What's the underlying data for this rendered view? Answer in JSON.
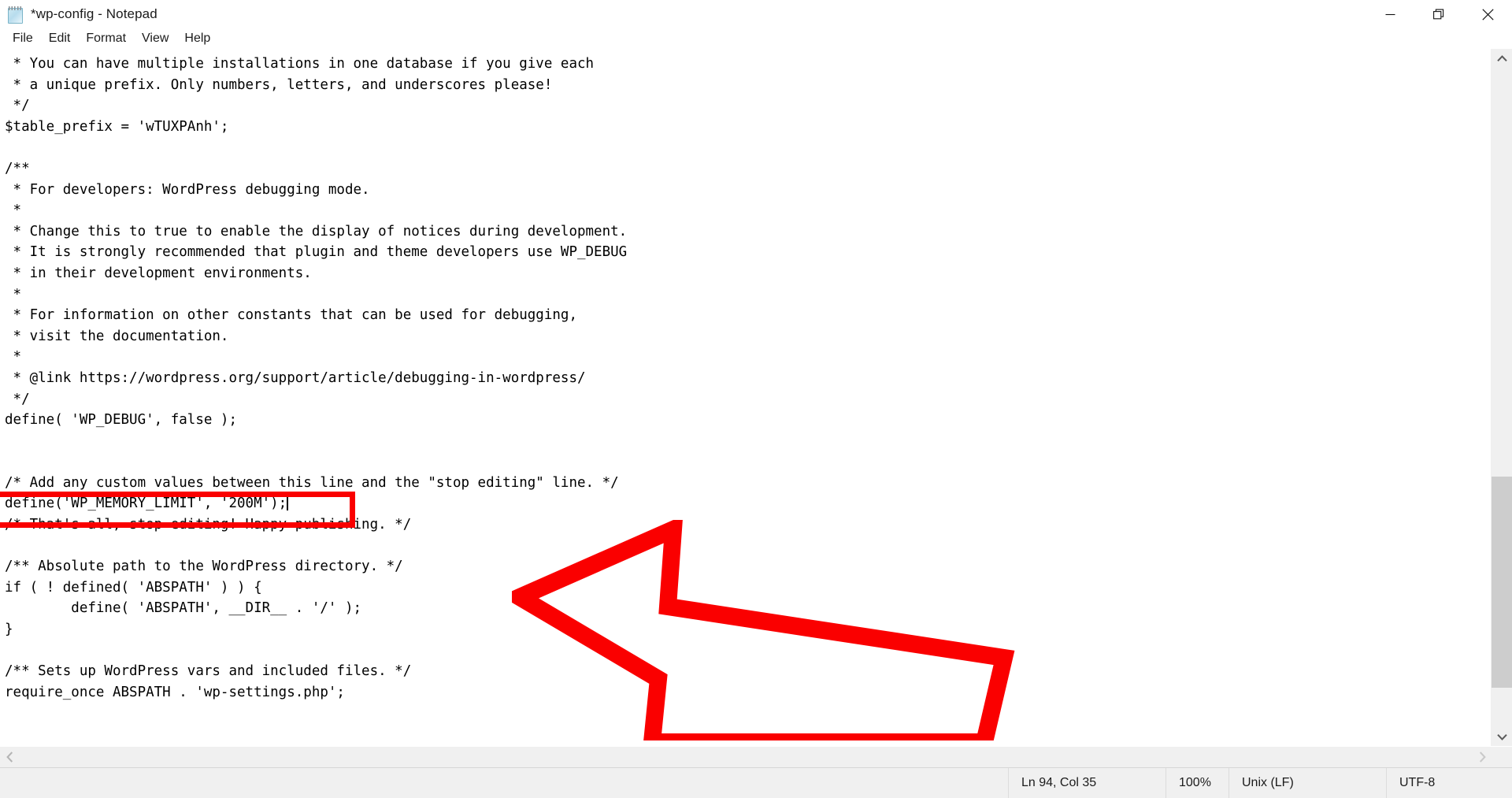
{
  "window": {
    "title": "*wp-config - Notepad",
    "icon": "notepad-icon",
    "controls": {
      "minimize": "minimize-icon",
      "restore": "restore-icon",
      "close": "close-icon"
    }
  },
  "menubar": {
    "items": [
      {
        "label": "File"
      },
      {
        "label": "Edit"
      },
      {
        "label": "Format"
      },
      {
        "label": "View"
      },
      {
        "label": "Help"
      }
    ]
  },
  "editor": {
    "lines": [
      " * You can have multiple installations in one database if you give each",
      " * a unique prefix. Only numbers, letters, and underscores please!",
      " */",
      "$table_prefix = 'wTUXPAnh';",
      "",
      "/**",
      " * For developers: WordPress debugging mode.",
      " *",
      " * Change this to true to enable the display of notices during development.",
      " * It is strongly recommended that plugin and theme developers use WP_DEBUG",
      " * in their development environments.",
      " *",
      " * For information on other constants that can be used for debugging,",
      " * visit the documentation.",
      " *",
      " * @link https://wordpress.org/support/article/debugging-in-wordpress/",
      " */",
      "define( 'WP_DEBUG', false );",
      "",
      "",
      "/* Add any custom values between this line and the \"stop editing\" line. */",
      "define('WP_MEMORY_LIMIT', '200M');",
      "/* That's all, stop editing! Happy publishing. */",
      "",
      "/** Absolute path to the WordPress directory. */",
      "if ( ! defined( 'ABSPATH' ) ) {",
      "        define( 'ABSPATH', __DIR__ . '/' );",
      "}",
      "",
      "/** Sets up WordPress vars and included files. */",
      "require_once ABSPATH . 'wp-settings.php';"
    ],
    "highlighted_line_index": 21,
    "highlighted_line_text": "define('WP_MEMORY_LIMIT', '200M');",
    "caret_after_line_index": 21
  },
  "annotation": {
    "type": "arrow",
    "direction": "left",
    "color": "#fa0000",
    "points_to": "define('WP_MEMORY_LIMIT', '200M');",
    "highlight_box_color": "#fa0000"
  },
  "scrollbars": {
    "vertical": {
      "up_icon": "chevron-up-icon",
      "down_icon": "chevron-down-icon",
      "thumb_top_pct": 62,
      "thumb_height_pct": 32
    },
    "horizontal": {
      "left_icon": "chevron-left-icon",
      "right_icon": "chevron-right-icon"
    }
  },
  "statusbar": {
    "position": "Ln 94, Col 35",
    "zoom": "100%",
    "line_ending": "Unix (LF)",
    "encoding": "UTF-8"
  }
}
